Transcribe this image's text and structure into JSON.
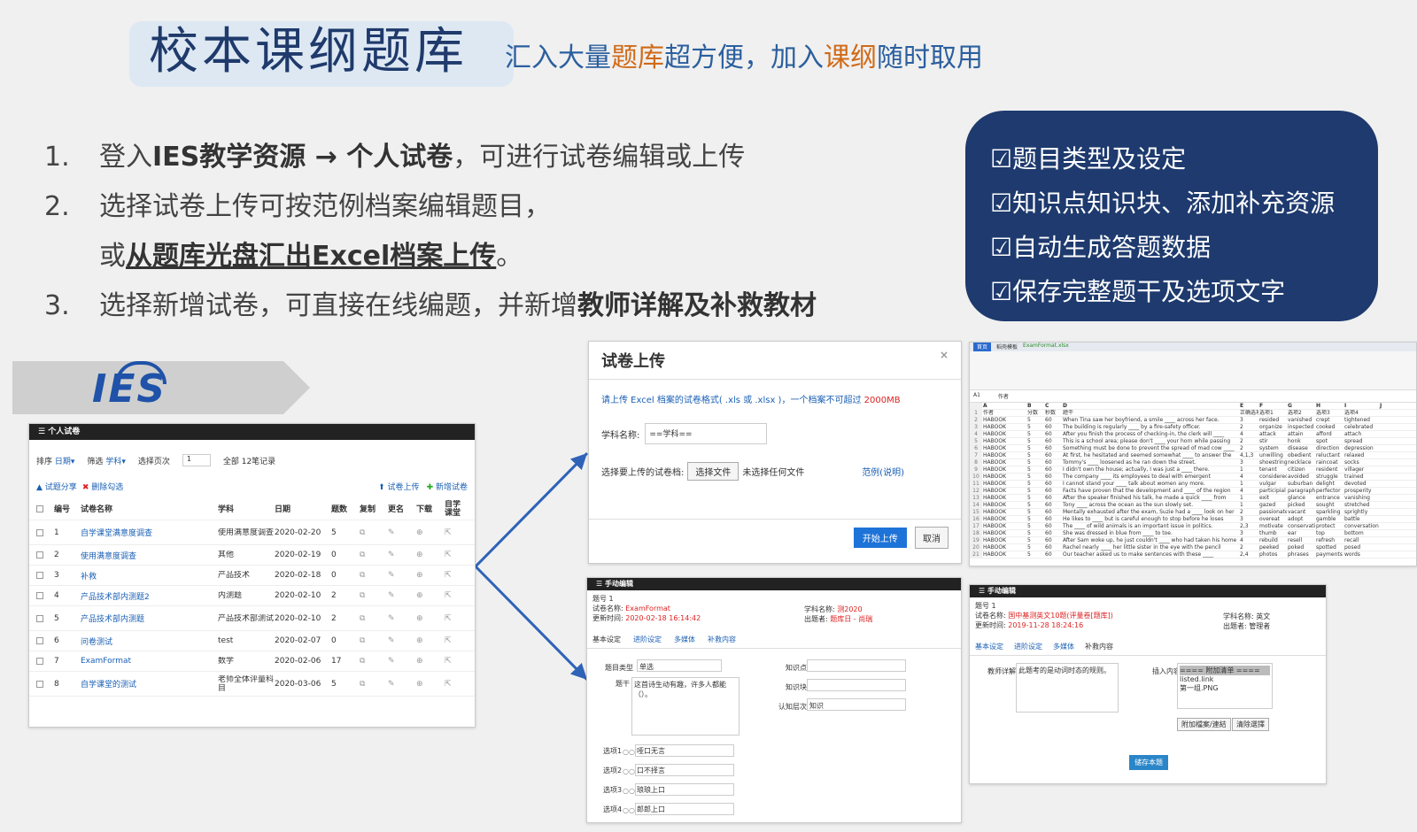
{
  "header": {
    "title": "校本课纲题库",
    "subtitle_parts": [
      "汇入大量",
      "题库",
      "超方便，加入",
      "课纲",
      "随时取用"
    ]
  },
  "steps": [
    {
      "num": "1.",
      "pre": "登入",
      "bold": "IES教学资源 → 个人试卷",
      "post": "，可进行试卷编辑或上传"
    },
    {
      "num": "2.",
      "pre": "选择试卷上传可按范例档案编辑题目，",
      "bold": "",
      "post": ""
    },
    {
      "num": "",
      "pre": "或",
      "underline": "从题库光盘汇出Excel档案上传",
      "post": "。"
    },
    {
      "num": "3.",
      "pre": "选择新增试卷，可直接在线编题，并新增",
      "bold": "教师详解及补救教材",
      "post": ""
    }
  ],
  "features": [
    "☑题目类型及设定",
    "☑知识点知识块、添加补充资源",
    "☑自动生成答题数据",
    "☑保存完整题干及选项文字"
  ],
  "logo": "IES",
  "list_panel": {
    "bar": "个人试卷",
    "sort_label": "排序",
    "sort_value": "日期▾",
    "filter_label": "筛选",
    "filter_value": "学科▾",
    "page_label": "选择页次",
    "page_value": "1",
    "total": "全部 12笔记录",
    "share": "试题分享",
    "delete": "删除勾选",
    "upload": "试卷上传",
    "new": "新增试卷",
    "columns": [
      "编号",
      "试卷名称",
      "学科",
      "日期",
      "题数",
      "复制",
      "更名",
      "下载",
      "自学课堂"
    ],
    "rows": [
      {
        "no": "1",
        "name": "自学课堂满意度调查",
        "subject": "使用满意度调查",
        "date": "2020-02-20",
        "count": "5"
      },
      {
        "no": "2",
        "name": "使用满意度调查",
        "subject": "其他",
        "date": "2020-02-19",
        "count": "0"
      },
      {
        "no": "3",
        "name": "补救",
        "subject": "产品技术",
        "date": "2020-02-18",
        "count": "0"
      },
      {
        "no": "4",
        "name": "产品技术部内测题2",
        "subject": "内测题",
        "date": "2020-02-10",
        "count": "2"
      },
      {
        "no": "5",
        "name": "产品技术部内测题",
        "subject": "产品技术部测试",
        "date": "2020-02-10",
        "count": "2"
      },
      {
        "no": "6",
        "name": "问卷测试",
        "subject": "test",
        "date": "2020-02-07",
        "count": "0"
      },
      {
        "no": "7",
        "name": "ExamFormat",
        "subject": "数学",
        "date": "2020-02-06",
        "count": "17"
      },
      {
        "no": "8",
        "name": "自学课堂的测试",
        "subject": "老师全体评量科目",
        "date": "2020-03-06",
        "count": "5"
      }
    ]
  },
  "upload_panel": {
    "title": "试卷上传",
    "close": "×",
    "hint_pre": "请上传 Excel 档案的试卷格式( .xls 或 .xlsx )，一个档案不可超过 ",
    "hint_size": "2000MB",
    "subject_label": "学科名称:",
    "subject_value": "==学科==",
    "file_label": "选择要上传的试卷档:",
    "file_button": "选择文件",
    "file_status": "未选择任何文件",
    "example": "范例(说明)",
    "start": "开始上传",
    "cancel": "取消"
  },
  "manual1": {
    "bar": "手动编辑",
    "qno": "题号 1",
    "name_label": "试卷名称:",
    "name_value": "ExamFormat",
    "subject_label": "学科名称:",
    "subject_value": "测2020",
    "time_label": "更新时间:",
    "time_value": "2020-02-18 16:14:42",
    "author_label": "出题者:",
    "author_value": "题库日 - 尚瑞",
    "tabs": [
      "基本设定",
      "进阶设定",
      "多媒体",
      "补救内容"
    ],
    "type_label": "题目类型",
    "type_value": "单选",
    "stem_label": "题干",
    "stem_value": "这首诗生动有趣，许多人都能（）。",
    "kp_label": "知识点",
    "kb_label": "知识块",
    "level_label": "认知层次",
    "level_value": "知识",
    "options": [
      {
        "label": "选项1",
        "value": "哑口无言"
      },
      {
        "label": "选项2",
        "value": "口不择言"
      },
      {
        "label": "选项3",
        "value": "琅琅上口"
      },
      {
        "label": "选项4",
        "value": "郎郎上口"
      }
    ]
  },
  "manual2": {
    "bar": "手动编辑",
    "qno": "题号 1",
    "name_label": "试卷名称:",
    "name_value": "国中基测英文10题(评量卷[题库])",
    "subject_label": "学科名称:",
    "subject_value": "英文",
    "time_label": "更新时间:",
    "time_value": "2019-11-28 18:24:16",
    "author_label": "出题者:",
    "author_value": "管理者",
    "tabs": [
      "基本设定",
      "进阶设定",
      "多媒体",
      "补救内容"
    ],
    "explain_label": "教师详解",
    "explain_value": "此题考的是动词时态的规则。",
    "insert_label": "插入内容",
    "insert_items": [
      "==== 附加清单 ====",
      "listed.link",
      "第一组.PNG"
    ],
    "attach_button": "附加檔案/連結",
    "clear_button": "清除選擇",
    "save": "储存本题"
  },
  "sheet": {
    "tabs": [
      "首页",
      "稻壳模板",
      "ExamFormat.xlsx"
    ],
    "cell_ref": "A1",
    "cell_value": "作者",
    "columns": [
      "A",
      "B",
      "C",
      "D",
      "E",
      "F",
      "G",
      "H",
      "I",
      "J"
    ],
    "header_row": [
      "作者",
      "分数",
      "秒数",
      "题干",
      "正确选项",
      "选项1",
      "选项2",
      "选项3",
      "选项4"
    ],
    "rows": [
      [
        "HABOOK",
        "5",
        "60",
        "When Tina saw her boyfriend, a smile ____ across her face.",
        "3",
        "resided",
        "vanished",
        "crept",
        "tightened"
      ],
      [
        "HABOOK",
        "5",
        "60",
        "The building is regularly ____ by a fire-safety officer.",
        "2",
        "organize",
        "inspected",
        "cooked",
        "celebrated"
      ],
      [
        "HABOOK",
        "5",
        "60",
        "After you finish the process of checking-in, the clerk will ____",
        "4",
        "attack",
        "attain",
        "afford",
        "attach"
      ],
      [
        "HABOOK",
        "5",
        "60",
        "This is a school area; please don't ____ your horn while passing",
        "2",
        "stir",
        "honk",
        "spot",
        "spread"
      ],
      [
        "HABOOK",
        "5",
        "60",
        "Something must be done to prevent the spread of mad cow ____",
        "2",
        "system",
        "disease",
        "direction",
        "depression"
      ],
      [
        "HABOOK",
        "5",
        "60",
        "At first, he hesitated and seemed somewhat ____ to answer the",
        "4,1,3",
        "unwilling",
        "obedient",
        "reluctant",
        "relaxed"
      ],
      [
        "HABOOK",
        "5",
        "60",
        "Tommy's ____ loosened as he ran down the street.",
        "3",
        "shoestring",
        "necklace",
        "raincoat",
        "socks"
      ],
      [
        "HABOOK",
        "5",
        "60",
        "I didn't own the house; actually, I was just a ____ there.",
        "1",
        "tenant",
        "citizen",
        "resident",
        "villager"
      ],
      [
        "HABOOK",
        "5",
        "60",
        "The company ____ its employees to deal with emergent",
        "4",
        "considered",
        "avoided",
        "struggle",
        "trained"
      ],
      [
        "HABOOK",
        "5",
        "60",
        "I cannot stand your ____ talk about women any more.",
        "1",
        "vulgar",
        "suburban",
        "delight",
        "devoted"
      ],
      [
        "HABOOK",
        "5",
        "60",
        "Facts have proven that the development and ____ of the region",
        "4",
        "participial",
        "paragraph",
        "perfector",
        "prosperity"
      ],
      [
        "HABOOK",
        "5",
        "60",
        "After the speaker finished his talk, he made a quick ____ from",
        "1",
        "exit",
        "glance",
        "entrance",
        "vanishing"
      ],
      [
        "HABOOK",
        "5",
        "60",
        "Tony ____ across the ocean as the sun slowly set.",
        "1",
        "gazed",
        "picked",
        "sought",
        "stretched"
      ],
      [
        "HABOOK",
        "5",
        "60",
        "Mentally exhausted after the exam, Suzie had a ____ look on her",
        "2",
        "passionate",
        "vacant",
        "sparkling",
        "sprightly"
      ],
      [
        "HABOOK",
        "5",
        "60",
        "He likes to ____ but is careful enough to stop before he loses",
        "3",
        "overeat",
        "adopt",
        "gamble",
        "battle"
      ],
      [
        "HABOOK",
        "5",
        "60",
        "The ____ of wild animals is an important issue in politics.",
        "2,3",
        "motivate",
        "conservation",
        "protect",
        "conversation"
      ],
      [
        "HABOOK",
        "5",
        "60",
        "She was dressed in blue from ____ to toe.",
        "3",
        "thumb",
        "ear",
        "top",
        "bottom"
      ],
      [
        "HABOOK",
        "5",
        "60",
        "After Sam woke up, he just couldn't ____ who had taken his home",
        "4",
        "rebuild",
        "resell",
        "refresh",
        "recall"
      ],
      [
        "HABOOK",
        "5",
        "60",
        "Rachel nearly ____ her little sister in the eye with the pencil",
        "2",
        "peeked",
        "poked",
        "spotted",
        "posed"
      ],
      [
        "HABOOK",
        "5",
        "60",
        "Our teacher asked us to make sentences with these ____",
        "2,4",
        "photos",
        "phrases",
        "payments",
        "words"
      ]
    ]
  }
}
